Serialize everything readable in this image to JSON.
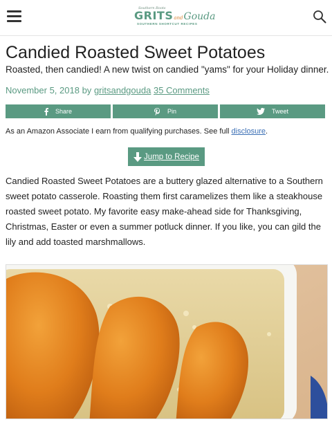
{
  "header": {
    "logo": {
      "tagline": "Southern Roots",
      "grits": "GRITS",
      "and": "and",
      "gouda": "Gouda",
      "sub": "SOUTHERN SHORTCUT RECIPES"
    },
    "menu_icon": "hamburger-icon",
    "search_icon": "search-icon"
  },
  "post": {
    "title": "Candied Roasted Sweet Potatoes",
    "subtitle": "Roasted, then candied! A new twist on candied \"yams\" for your Holiday dinner.",
    "date": "November 5, 2018",
    "by": "by",
    "author": "gritsandgouda",
    "comments": "35 Comments"
  },
  "share": [
    {
      "label": "Share",
      "icon": "facebook-icon"
    },
    {
      "label": "Pin",
      "icon": "pinterest-icon"
    },
    {
      "label": "Tweet",
      "icon": "twitter-icon"
    }
  ],
  "disclosure": {
    "text": "As an Amazon Associate I earn from qualifying purchases. See full ",
    "link": "disclosure",
    "end": "."
  },
  "jump_button": {
    "label": "Jump to Recipe",
    "icon": "arrow-down-icon"
  },
  "intro": "Candied Roasted Sweet Potatoes are a buttery glazed alternative to a Southern sweet potato casserole. Roasting them first caramelizes them like a steakhouse roasted sweet potato. My favorite easy make-ahead side for Thanksgiving, Christmas, Easter or even a summer potluck dinner. If you like, you can gild the lily and add toasted marshmallows.",
  "colors": {
    "accent": "#5a9a82",
    "link": "#3b6fb5",
    "logo_and": "#d9873a"
  }
}
